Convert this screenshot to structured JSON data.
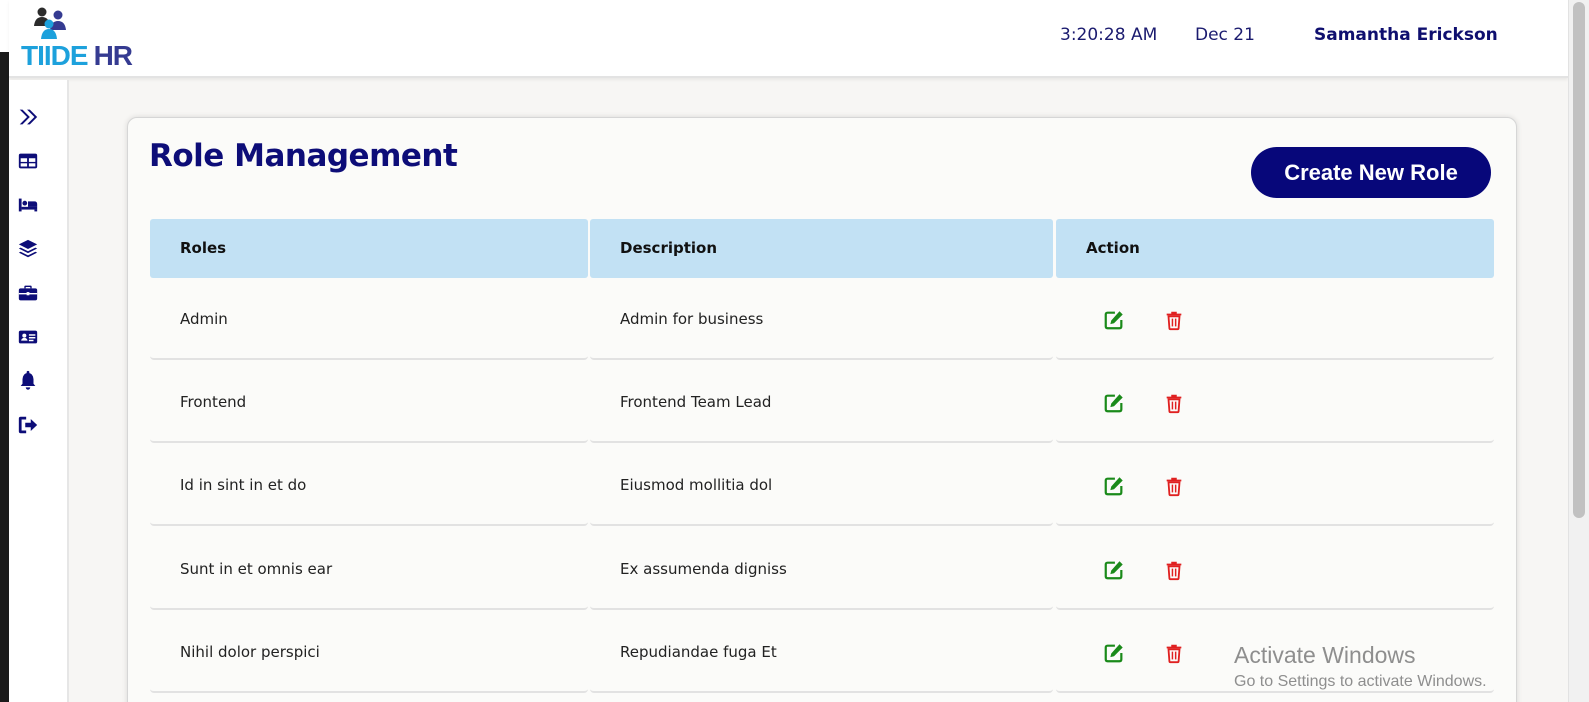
{
  "app": {
    "brand_part1": "TIIDE",
    "brand_part2": "HR"
  },
  "header": {
    "time": "3:20:28 AM",
    "date": "Dec 21",
    "user_name": "Samantha Erickson"
  },
  "sidebar": {
    "items": [
      {
        "icon": "double-chevron-right-icon"
      },
      {
        "icon": "table-icon"
      },
      {
        "icon": "bed-icon"
      },
      {
        "icon": "layers-icon"
      },
      {
        "icon": "briefcase-icon"
      },
      {
        "icon": "id-card-icon"
      },
      {
        "icon": "bell-icon"
      },
      {
        "icon": "sign-out-icon"
      }
    ]
  },
  "page": {
    "title": "Role Management",
    "create_button_label": "Create New Role"
  },
  "table": {
    "columns": [
      "Roles",
      "Description",
      "Action"
    ],
    "rows": [
      {
        "role": "Admin",
        "description": "Admin for business"
      },
      {
        "role": "Frontend",
        "description": "Frontend Team Lead"
      },
      {
        "role": "Id in sint in et do",
        "description": "Eiusmod mollitia dol"
      },
      {
        "role": "Sunt in et omnis ear",
        "description": "Ex assumenda digniss"
      },
      {
        "role": "Nihil dolor perspici",
        "description": "Repudiandae fuga Et"
      }
    ],
    "action_icons": {
      "edit": "edit-icon",
      "delete": "trash-icon"
    }
  },
  "colors": {
    "primary": "#07077a",
    "header_bg": "#c2e1f4",
    "edit": "#1a8a1a",
    "delete": "#e02020",
    "brand_light": "#1da1dc",
    "brand_dark": "#353b91"
  },
  "os_watermark": {
    "line1": "Activate Windows",
    "line2": "Go to Settings to activate Windows."
  }
}
